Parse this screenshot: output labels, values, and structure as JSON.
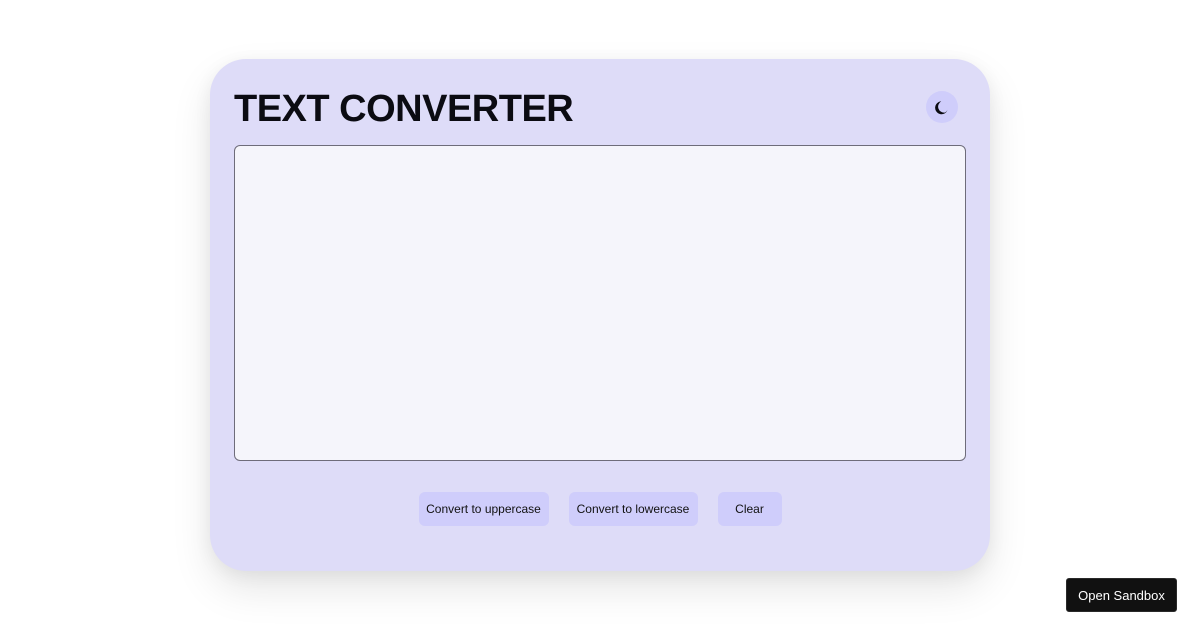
{
  "app": {
    "title": "TEXT CONVERTER"
  },
  "theme_toggle": {
    "icon": "moon-icon"
  },
  "editor": {
    "value": "",
    "placeholder": ""
  },
  "actions": {
    "uppercase_label": "Convert to uppercase",
    "lowercase_label": "Convert to lowercase",
    "clear_label": "Clear"
  },
  "sandbox": {
    "label": "Open Sandbox"
  },
  "colors": {
    "card_background": "#dedcf8",
    "button_background": "#cfcdfb",
    "textarea_background": "#f5f5fb",
    "sandbox_background": "#111111"
  }
}
